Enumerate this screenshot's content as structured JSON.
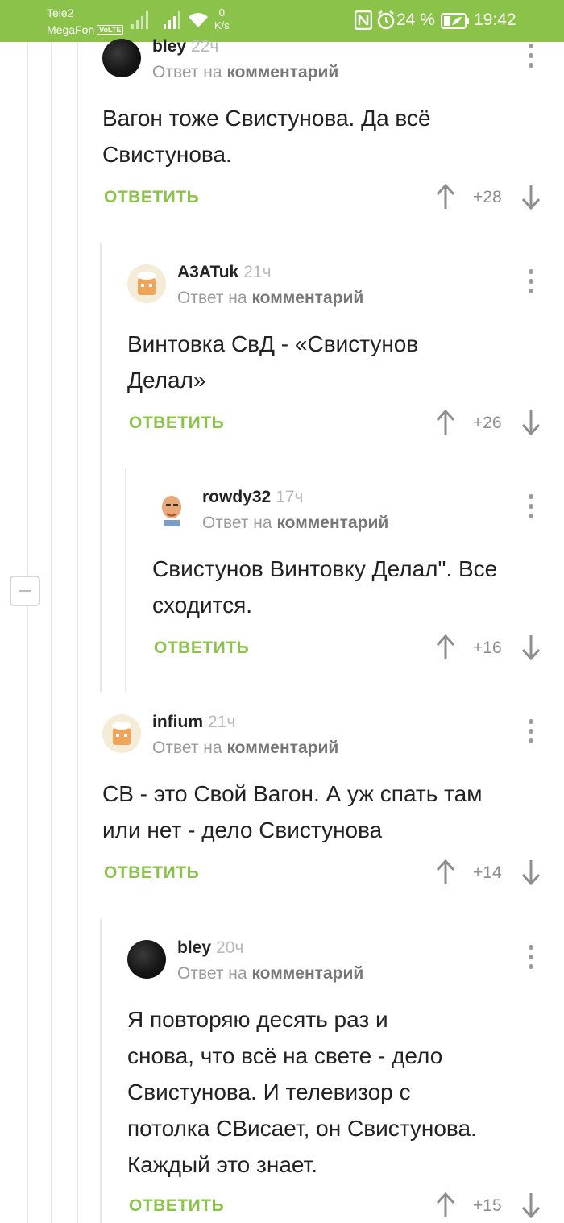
{
  "status_bar": {
    "carrier1": "Tele2",
    "carrier2": "MegaFon",
    "volte": "VoLTE",
    "net_speed_value": "0",
    "net_speed_unit": "K/s",
    "battery": "24 %",
    "time": "19:42"
  },
  "colors": {
    "accent": "#8bc34a",
    "status_bar": "#8bc34a",
    "thread_line": "#e6e6e6"
  },
  "comments": [
    {
      "username": "bley",
      "time": "22ч",
      "reply_prefix": "Ответ на",
      "reply_target": "комментарий",
      "text_lines": [
        "Вагон тоже Свистунова. Да всё",
        "Свистунова."
      ],
      "reply_label": "ОТВЕТИТЬ",
      "score": "+28",
      "avatar": "dark-avatar"
    },
    {
      "username": "A3ATuk",
      "time": "21ч",
      "reply_prefix": "Ответ на",
      "reply_target": "комментарий",
      "text_lines": [
        "Винтовка СвД - «Свистунов",
        "Делал»"
      ],
      "reply_label": "ОТВЕТИТЬ",
      "score": "+26",
      "avatar": "cook-avatar"
    },
    {
      "username": "rowdy32",
      "time": "17ч",
      "reply_prefix": "Ответ на",
      "reply_target": "комментарий",
      "text_lines": [
        "Свистунов Винтовку Делал\". Все",
        "сходится."
      ],
      "reply_label": "ОТВЕТИТЬ",
      "score": "+16",
      "avatar": "face-avatar"
    },
    {
      "username": "infium",
      "time": "21ч",
      "reply_prefix": "Ответ на",
      "reply_target": "комментарий",
      "text_lines": [
        "СВ - это Свой Вагон. А уж спать там",
        "или нет - дело Свистунова"
      ],
      "reply_label": "ОТВЕТИТЬ",
      "score": "+14",
      "avatar": "cook-avatar"
    },
    {
      "username": "bley",
      "time": "20ч",
      "reply_prefix": "Ответ на",
      "reply_target": "комментарий",
      "text_lines": [
        "Я повторяю десять раз и",
        "снова, что всё на свете - дело",
        "Свистунова. И телевизор с",
        "потолка СВисает, он Свистунова.",
        "Каждый это знает."
      ],
      "reply_label": "ОТВЕТИТЬ",
      "score": "+15",
      "avatar": "dark-avatar"
    }
  ]
}
